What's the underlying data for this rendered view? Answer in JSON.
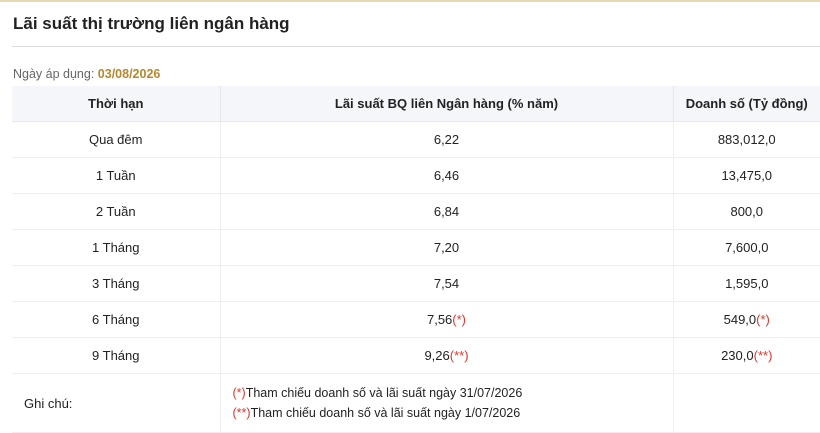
{
  "header": {
    "title": "Lãi suất thị trường liên ngân hàng"
  },
  "applied_date": {
    "label": "Ngày áp dụng:",
    "value": "03/08/2026"
  },
  "table": {
    "columns": [
      "Thời hạn",
      "Lãi suất BQ liên Ngân hàng (% năm)",
      "Doanh số (Tỷ đồng)"
    ],
    "rows": [
      {
        "term": "Qua đêm",
        "rate": "6,22",
        "rate_mark": "",
        "volume": "883,012,0",
        "volume_mark": ""
      },
      {
        "term": "1 Tuần",
        "rate": "6,46",
        "rate_mark": "",
        "volume": "13,475,0",
        "volume_mark": ""
      },
      {
        "term": "2 Tuần",
        "rate": "6,84",
        "rate_mark": "",
        "volume": "800,0",
        "volume_mark": ""
      },
      {
        "term": "1 Tháng",
        "rate": "7,20",
        "rate_mark": "",
        "volume": "7,600,0",
        "volume_mark": ""
      },
      {
        "term": "3 Tháng",
        "rate": "7,54",
        "rate_mark": "",
        "volume": "1,595,0",
        "volume_mark": ""
      },
      {
        "term": "6 Tháng",
        "rate": "7,56",
        "rate_mark": "(*)",
        "volume": "549,0",
        "volume_mark": "(*)"
      },
      {
        "term": "9 Tháng",
        "rate": "9,26",
        "rate_mark": "(**)",
        "volume": "230,0",
        "volume_mark": "(**)"
      }
    ],
    "notes": {
      "label": "Ghi chú:",
      "items": [
        {
          "mark": "(*)",
          "text": "Tham chiếu doanh số và lãi suất ngày 31/07/2026"
        },
        {
          "mark": "(**)",
          "text": "Tham chiếu doanh số và lãi suất ngày 1/07/2026"
        }
      ]
    }
  },
  "colors": {
    "date_accent": "#b8862e",
    "mark_red": "#e0342f",
    "header_bg": "#f4f6f9"
  }
}
